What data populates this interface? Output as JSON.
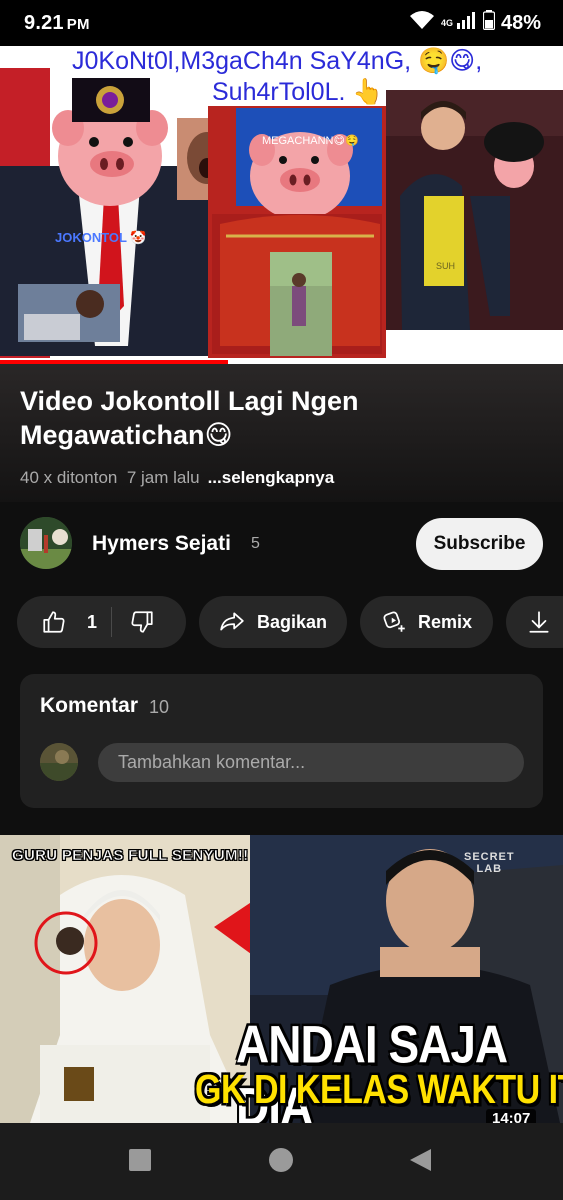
{
  "status_bar": {
    "time": "9.21",
    "ampm": "PM",
    "network": "4G",
    "battery": "48%"
  },
  "player": {
    "overlay_line1": "J0KoNt0l,M3gaCh4n SaY4nG, 🤤😋,",
    "overlay_line2": "Suh4rTol0L. 👆",
    "label_jokontol": "JOKONTOL 🤡",
    "label_megachann": "MEGACHANN😋🤤",
    "label_suh": "SUH",
    "progress": 0.405
  },
  "video": {
    "title": "Video Jokontoll Lagi Ngen Megawatichan😋",
    "views": "40 x ditonton",
    "time_ago": "7 jam lalu",
    "more": "...selengkapnya"
  },
  "channel": {
    "name": "Hymers Sejati",
    "subscriber_count": "5",
    "subscribe_label": "Subscribe"
  },
  "actions": {
    "like_count": "1",
    "share_label": "Bagikan",
    "remix_label": "Remix"
  },
  "comments": {
    "title": "Komentar",
    "count": "10",
    "placeholder": "Tambahkan komentar..."
  },
  "next_video": {
    "caption_top": "GURU PENJAS FULL SENYUM!!",
    "headline_1": "ANDAI SAJA DIA",
    "headline_2": "GK DI KELAS WAKTU ITU!",
    "logo_line1": "SECRET",
    "logo_line2": "LAB",
    "duration": "14:07"
  },
  "colors": {
    "background": "#0f0f0f",
    "accent_red": "#ff0000",
    "overlay_blue": "#2b2bd8",
    "pill": "#272727"
  }
}
